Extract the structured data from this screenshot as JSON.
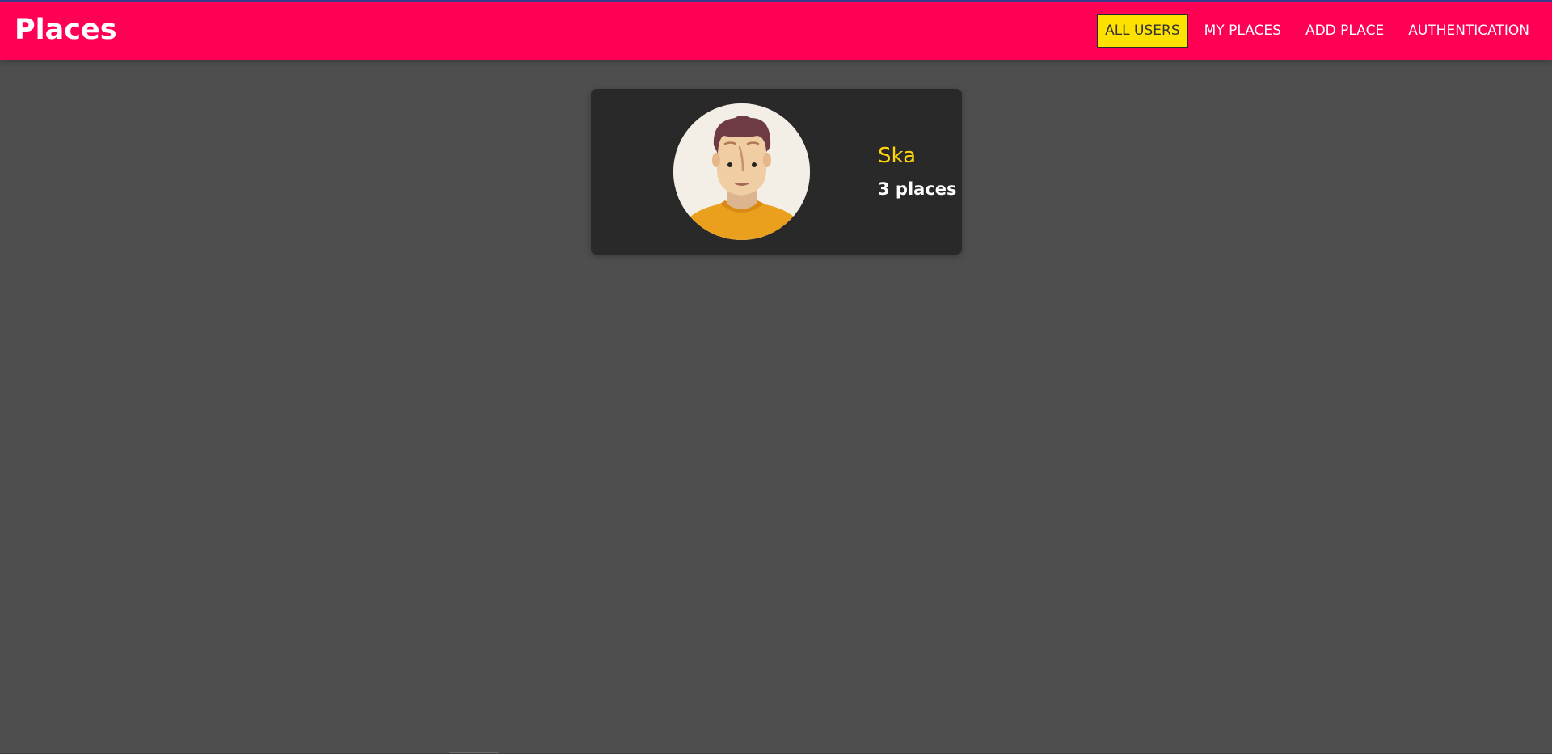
{
  "app": {
    "brand": "Places"
  },
  "nav": {
    "items": [
      {
        "label": "ALL USERS",
        "active": true
      },
      {
        "label": "MY PLACES",
        "active": false
      },
      {
        "label": "ADD PLACE",
        "active": false
      },
      {
        "label": "AUTHENTICATION",
        "active": false
      }
    ]
  },
  "users": [
    {
      "name": "Ska",
      "places_label": "3 places"
    }
  ],
  "colors": {
    "header": "#ff0055",
    "active_nav": "#ffe100",
    "page_bg": "#4e4e4e",
    "card_bg": "#292929",
    "user_name": "#ffd60a"
  },
  "icons": {
    "avatar": "person-avatar-icon"
  }
}
